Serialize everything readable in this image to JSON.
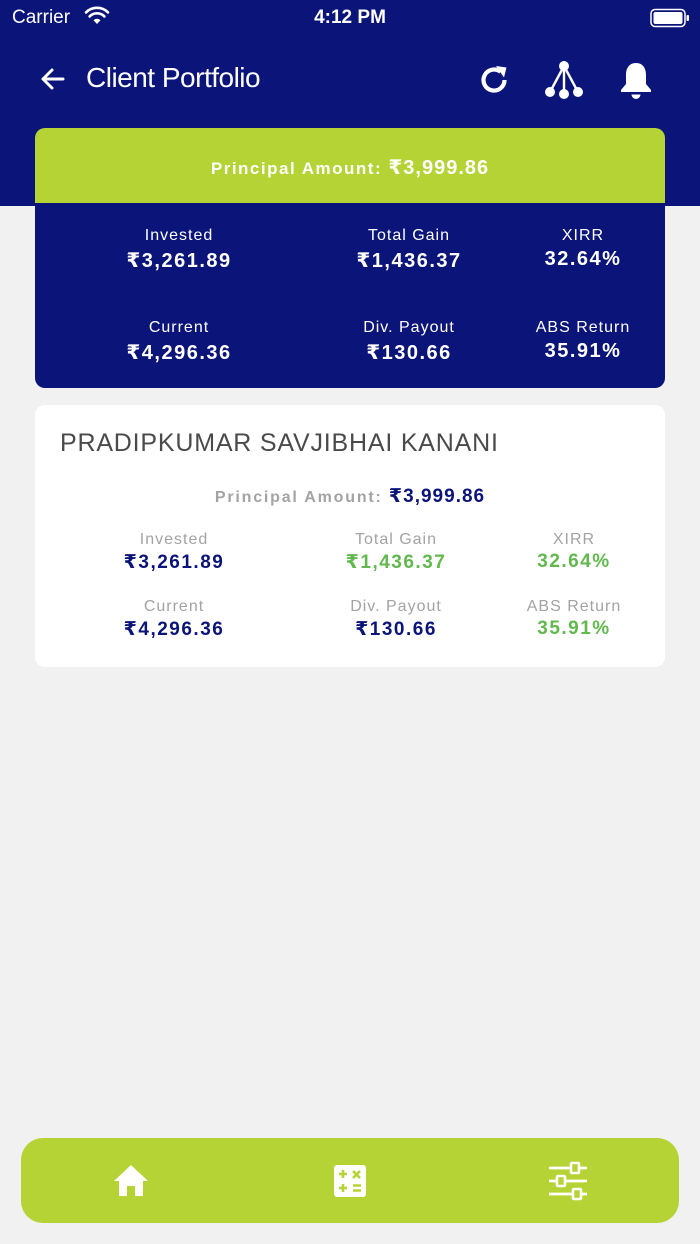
{
  "status_bar": {
    "carrier": "Carrier",
    "time": "4:12 PM"
  },
  "header": {
    "title": "Client Portfolio"
  },
  "summary": {
    "principal_label": "Principal Amount:",
    "principal_value": "₹3,999.86",
    "invested_label": "Invested",
    "invested_value": "₹3,261.89",
    "total_gain_label": "Total Gain",
    "total_gain_value": "₹1,436.37",
    "xirr_label": "XIRR",
    "xirr_value": "32.64%",
    "current_label": "Current",
    "current_value": "₹4,296.36",
    "div_payout_label": "Div. Payout",
    "div_payout_value": "₹130.66",
    "abs_return_label": "ABS Return",
    "abs_return_value": "35.91%"
  },
  "client": {
    "name": "PRADIPKUMAR SAVJIBHAI KANANI",
    "principal_label": "Principal Amount:",
    "principal_value": "₹3,999.86",
    "invested_label": "Invested",
    "invested_value": "₹3,261.89",
    "total_gain_label": "Total Gain",
    "total_gain_value": "₹1,436.37",
    "xirr_label": "XIRR",
    "xirr_value": "32.64%",
    "current_label": "Current",
    "current_value": "₹4,296.36",
    "div_payout_label": "Div. Payout",
    "div_payout_value": "₹130.66",
    "abs_return_label": "ABS Return",
    "abs_return_value": "35.91%"
  },
  "icons": {
    "back": "arrow-left-icon",
    "refresh": "refresh-icon",
    "network": "network-icon",
    "bell": "bell-icon",
    "home": "home-icon",
    "calculator": "calculator-icon",
    "filter": "sliders-icon"
  },
  "colors": {
    "primary": "#0b1478",
    "accent": "#b5d334",
    "positive": "#61b94e",
    "muted": "#a3a3a3"
  }
}
